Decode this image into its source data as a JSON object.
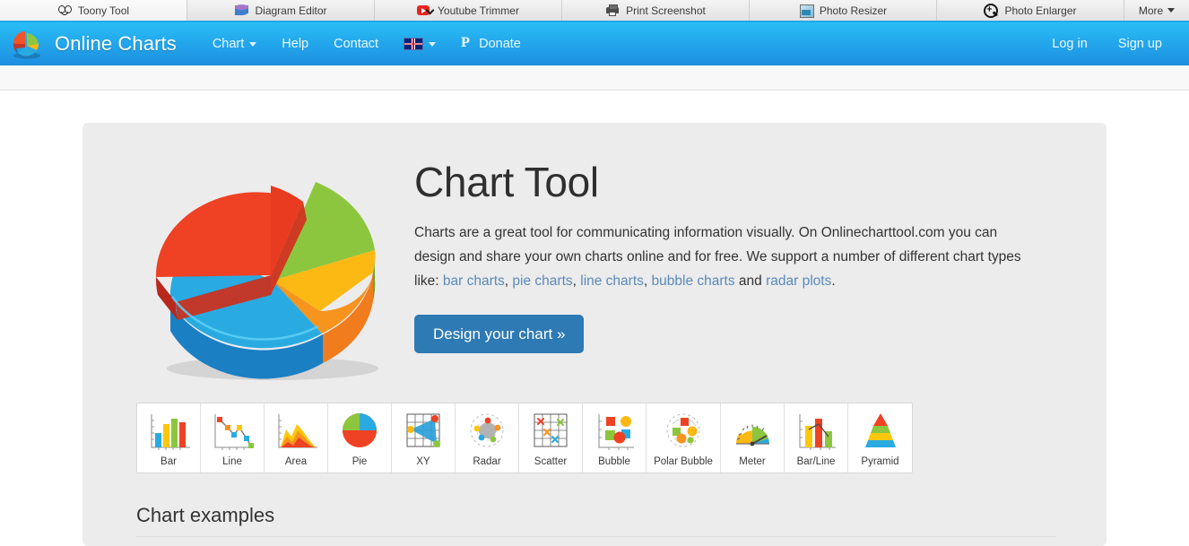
{
  "topbar": {
    "tabs": [
      {
        "label": "Toony Tool",
        "icon": "toony-tool-icon"
      },
      {
        "label": "Diagram Editor",
        "icon": "diagram-editor-icon"
      },
      {
        "label": "Youtube Trimmer",
        "icon": "youtube-trimmer-icon"
      },
      {
        "label": "Print Screenshot",
        "icon": "printer-icon"
      },
      {
        "label": "Photo Resizer",
        "icon": "photo-resizer-icon"
      },
      {
        "label": "Photo Enlarger",
        "icon": "magnifier-plus-icon"
      }
    ],
    "more_label": "More",
    "accent": "#21a8e8"
  },
  "nav": {
    "brand": "Online Charts",
    "brand_logo_icon": "pie-chart-logo-icon",
    "links": [
      {
        "label": "Chart",
        "caret": true
      },
      {
        "label": "Help",
        "caret": false
      },
      {
        "label": "Contact",
        "caret": false
      }
    ],
    "language": {
      "icon": "uk-flag-icon",
      "caret": true
    },
    "donate": {
      "label": "Donate",
      "icon": "paypal-icon"
    },
    "login_label": "Log in",
    "signup_label": "Sign up",
    "bg_top": "#29bff5",
    "bg_bottom": "#1d8fe0"
  },
  "hero": {
    "figure_icon": "exploded-3d-pie-chart-image",
    "title": "Chart Tool",
    "paragraph": {
      "part1": "Charts are a great tool for communicating information visually. On Onlinecharttool.com you can design and share your own charts online and for free. We support a number of different chart types like: ",
      "link1": "bar charts",
      "sep1": ", ",
      "link2": "pie charts",
      "sep2": ", ",
      "link3": "line charts",
      "sep3": ", ",
      "link4": "bubble charts",
      "sep4": " and ",
      "link5": "radar plots",
      "end": "."
    },
    "cta_label": "Design your chart »",
    "cta_color": "#2e7ab4",
    "link_color": "#5a89bd"
  },
  "chart_types": [
    {
      "label": "Bar",
      "icon": "bar-chart-icon"
    },
    {
      "label": "Line",
      "icon": "line-chart-icon"
    },
    {
      "label": "Area",
      "icon": "area-chart-icon"
    },
    {
      "label": "Pie",
      "icon": "pie-chart-icon"
    },
    {
      "label": "XY",
      "icon": "xy-chart-icon"
    },
    {
      "label": "Radar",
      "icon": "radar-chart-icon"
    },
    {
      "label": "Scatter",
      "icon": "scatter-chart-icon"
    },
    {
      "label": "Bubble",
      "icon": "bubble-chart-icon"
    },
    {
      "label": "Polar Bubble",
      "icon": "polar-bubble-chart-icon"
    },
    {
      "label": "Meter",
      "icon": "meter-chart-icon"
    },
    {
      "label": "Bar/Line",
      "icon": "bar-line-chart-icon"
    },
    {
      "label": "Pyramid",
      "icon": "pyramid-chart-icon"
    }
  ],
  "sections": {
    "examples_heading": "Chart examples"
  }
}
